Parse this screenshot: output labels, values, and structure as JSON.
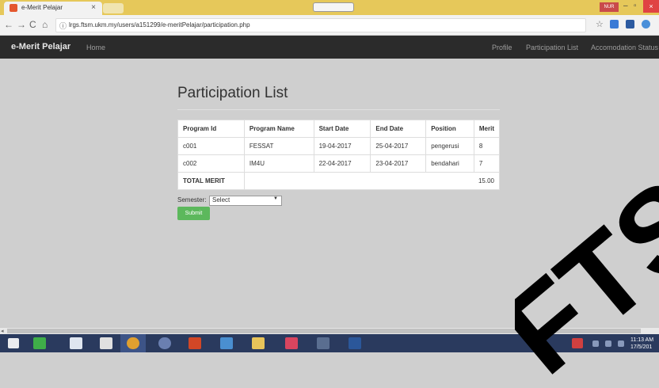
{
  "browser": {
    "tab_title": "e-Merit Pelajar",
    "tab_close": "×",
    "url": "lrgs.ftsm.ukm.my/users/a151299/e-meritPelajar/participation.php",
    "profile_label": "NUR",
    "back": "←",
    "forward": "→",
    "reload": "C",
    "home": "⌂",
    "info": "ⓘ",
    "star": "☆",
    "min": "–",
    "max": "▫",
    "close": "×"
  },
  "navbar": {
    "brand": "e-Merit Pelajar",
    "home": "Home",
    "profile": "Profile",
    "participation": "Participation List",
    "accommodation": "Accomodation Status"
  },
  "page": {
    "heading": "Participation List",
    "table": {
      "headers": [
        "Program Id",
        "Program Name",
        "Start Date",
        "End Date",
        "Position",
        "Merit"
      ],
      "rows": [
        [
          "c001",
          "FESSAT",
          "19-04-2017",
          "25-04-2017",
          "pengerusi",
          "8"
        ],
        [
          "c002",
          "IM4U",
          "22-04-2017",
          "23-04-2017",
          "bendahari",
          "7"
        ]
      ],
      "total_label": "TOTAL MERIT",
      "total_value": "15.00"
    },
    "semester_label": "Semester:",
    "semester_selected": "Select",
    "submit_label": "Submit"
  },
  "taskbar": {
    "time": "11:13 AM",
    "date": "17/5/201"
  },
  "watermark_text": "FTSM",
  "colors": {
    "navbar_bg": "#2b2b2b",
    "submit_green": "#5cb85c",
    "tabstrip": "#e6c85a",
    "taskbar": "#2a3a5e",
    "watermark": "#000000"
  }
}
